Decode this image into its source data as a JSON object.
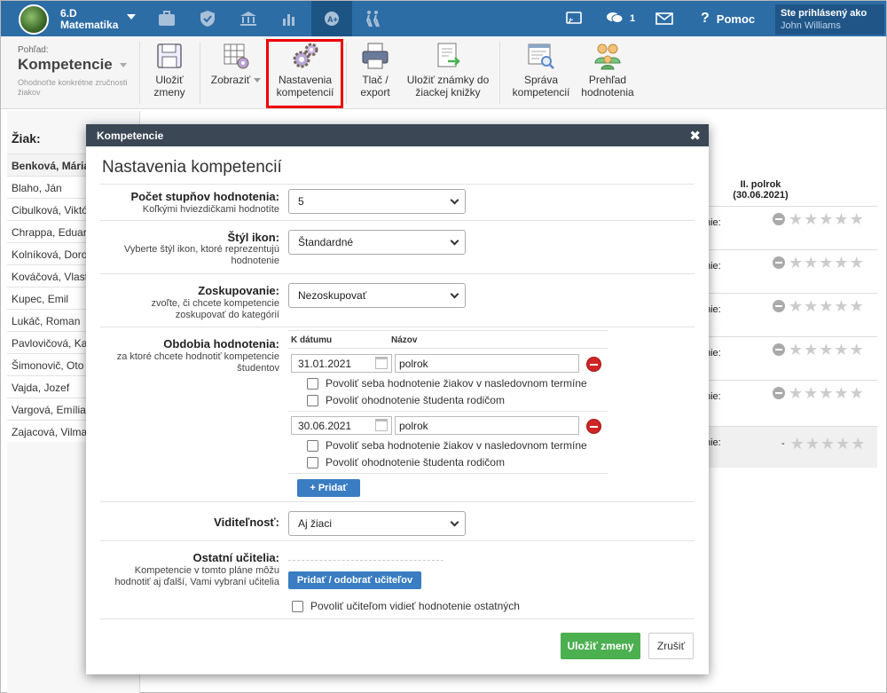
{
  "nav": {
    "class_line1": "6.D",
    "class_line2": "Matematika",
    "messages_count": "1",
    "help": "Pomoc",
    "signed_in_label": "Ste prihlásený ako",
    "user_name": "John Williams"
  },
  "toolbar": {
    "view_label": "Pohľad:",
    "view_title": "Kompetencie",
    "view_hint": "Ohodnoťte konkrétne zručnosti žiakov",
    "buttons": [
      {
        "l1": "Uložiť",
        "l2": "zmeny"
      },
      {
        "l1": "Zobraziť",
        "l2": ""
      },
      {
        "l1": "Nastavenia",
        "l2": "kompetencií"
      },
      {
        "l1": "Tlač /",
        "l2": "export"
      },
      {
        "l1": "Uložiť známky do",
        "l2": "žiackej knižky"
      },
      {
        "l1": "Správa",
        "l2": "kompetencií"
      },
      {
        "l1": "Prehľad",
        "l2": "hodnotenia"
      }
    ]
  },
  "students": {
    "heading": "Žiak:",
    "items": [
      "Benková, Mária",
      "Blaho, Ján",
      "Cibulková, Viktória",
      "Chrappa, Eduard",
      "Kolníková, Dorota",
      "Kováčová, Vlasta",
      "Kupec, Emil",
      "Lukáč, Roman",
      "Pavlovičová, Katarína",
      "Šimonovič, Oto",
      "Vajda, Jozef",
      "Vargová, Emília",
      "Zajacová, Vilma"
    ]
  },
  "grid": {
    "period_title": "II. polrok",
    "period_date": "(30.06.2021)",
    "row_label": "nie:",
    "row_label2": "nie:",
    "dash": "-"
  },
  "modal": {
    "header": "Kompetencie",
    "close": "✖",
    "title": "Nastavenia kompetencií",
    "steps_label": "Počet stupňov hodnotenia:",
    "steps_hint": "Koľkými hviezdičkami hodnotíte",
    "steps_value": "5",
    "icons_label": "Štýl ikon:",
    "icons_hint": "Vyberte štýl ikon, ktoré reprezentujú hodnotenie",
    "icons_value": "Štandardné",
    "group_label": "Zoskupovanie:",
    "group_hint": "zvoľte, či chcete kompetencie zoskupovať do kategórií",
    "group_value": "Nezoskupovať",
    "periods_label": "Obdobia hodnotenia:",
    "periods_hint": "za ktoré chcete hodnotiť kompetencie študentov",
    "col_date": "K dátumu",
    "col_name": "Názov",
    "periods": [
      {
        "date": "31.01.2021",
        "name": "polrok",
        "cb1": "Povoliť seba hodnotenie žiakov v nasledovnom termíne",
        "cb2": "Povoliť ohodnotenie študenta rodičom"
      },
      {
        "date": "30.06.2021",
        "name": "polrok",
        "cb1": "Povoliť seba hodnotenie žiakov v nasledovnom termíne",
        "cb2": "Povoliť ohodnotenie študenta rodičom"
      }
    ],
    "add_label": "+ Pridať",
    "visibility_label": "Viditeľnosť:",
    "visibility_value": "Aj žiaci",
    "teachers_label": "Ostatní učitelia:",
    "teachers_hint": "Kompetencie v tomto pláne môžu hodnotiť aj ďalší, Vami vybraní učitelia",
    "teachers_button": "Pridať / odobrať učiteľov",
    "teachers_cb": "Povoliť učiteľom vidieť hodnotenie ostatných",
    "save": "Uložiť zmeny",
    "cancel": "Zrušiť"
  }
}
